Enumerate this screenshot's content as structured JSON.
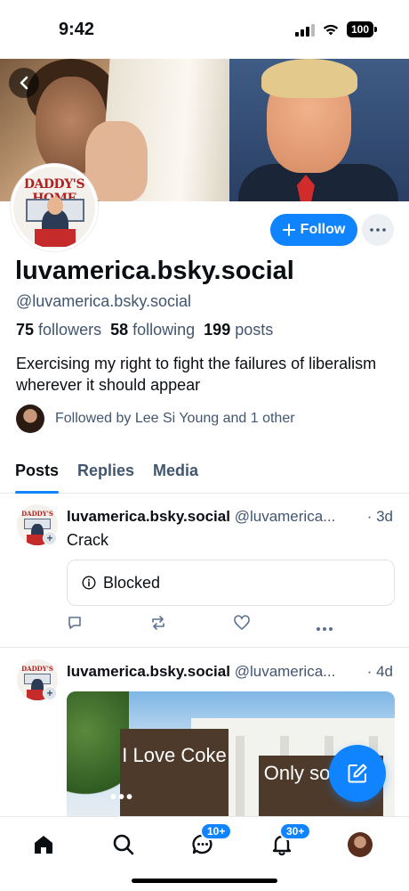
{
  "status_bar": {
    "time": "9:42",
    "battery": "100"
  },
  "profile": {
    "display_name": "luvamerica.bsky.social",
    "handle": "@luvamerica.bsky.social",
    "avatar_text": "DADDY'S HOME",
    "followers_count": "75",
    "followers_label": "followers",
    "following_count": "58",
    "following_label": "following",
    "posts_count": "199",
    "posts_label": "posts",
    "bio": "Exercising my right to fight the failures of liberalism wherever it should appear",
    "followed_by": "Followed by Lee Si Young and 1 other",
    "follow_label": "Follow"
  },
  "tabs": [
    {
      "label": "Posts",
      "active": true
    },
    {
      "label": "Replies",
      "active": false
    },
    {
      "label": "Media",
      "active": false
    }
  ],
  "posts": [
    {
      "author": "luvamerica.bsky.social",
      "handle": "@luvamerica...",
      "time": "· 3d",
      "text": "Crack",
      "embed": "Blocked"
    },
    {
      "author": "luvamerica.bsky.social",
      "handle": "@luvamerica...",
      "time": "· 4d",
      "sign_left": "I Love Coke",
      "sign_right": "Only son can"
    }
  ],
  "nav": {
    "messages_badge": "10+",
    "notifications_badge": "30+"
  },
  "colors": {
    "accent": "#1083fe",
    "muted": "#42566f"
  }
}
